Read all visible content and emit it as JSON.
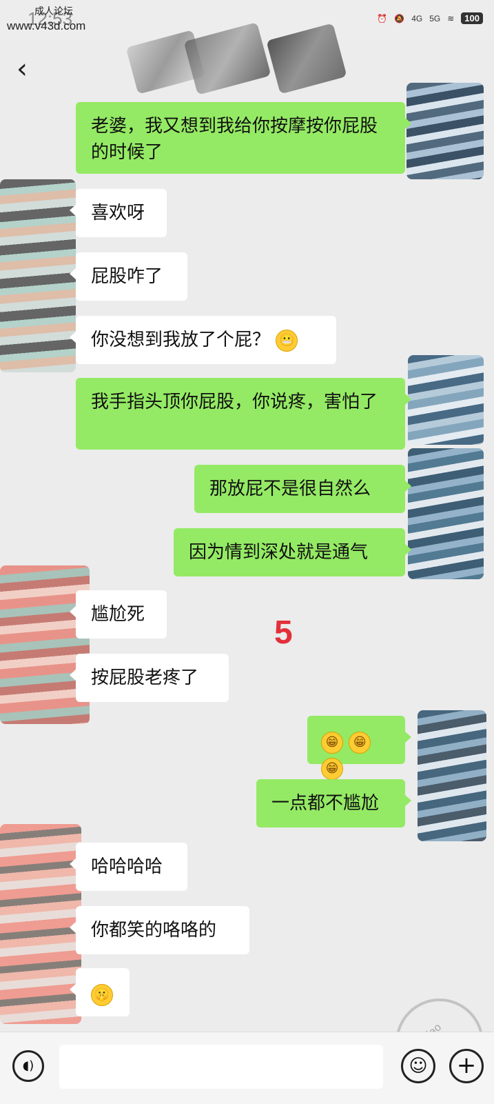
{
  "status_bar": {
    "time": "12:53",
    "watermark_top": "成人论坛",
    "watermark_url": "www.v43d.com",
    "network_1": "4G",
    "network_2": "5G",
    "battery": "100"
  },
  "nav": {
    "back_icon": "chevron-left-icon"
  },
  "messages": [
    {
      "side": "right",
      "text": "老婆，我又想到我给你按摩按你屁股的时候了"
    },
    {
      "side": "left",
      "text": "喜欢呀"
    },
    {
      "side": "left",
      "text": "屁股咋了"
    },
    {
      "side": "left",
      "text": "你没想到我放了个屁？",
      "emoji": "tearful-grin-emoji"
    },
    {
      "side": "right",
      "text": "我手指头顶你屁股，你说疼，害怕了"
    },
    {
      "side": "right",
      "text": "那放屁不是很自然么"
    },
    {
      "side": "right",
      "text": "因为情到深处就是通气"
    },
    {
      "side": "left",
      "text": "尴尬死"
    },
    {
      "side": "left",
      "text": "按屁股老疼了"
    },
    {
      "side": "right",
      "text": "",
      "emoji": "grin-emoji x3"
    },
    {
      "side": "right",
      "text": "一点都不尴尬"
    },
    {
      "side": "left",
      "text": "哈哈哈哈"
    },
    {
      "side": "left",
      "text": "你都笑的咯咯的"
    },
    {
      "side": "left",
      "text": "",
      "emoji": "shush-emoji"
    }
  ],
  "overlay_mark": "5",
  "stamp_text": "haijiao",
  "colors": {
    "sent_bubble": "#94ea64",
    "received_bubble": "#ffffff",
    "background": "#ececec",
    "mark_red": "#e2303a"
  }
}
